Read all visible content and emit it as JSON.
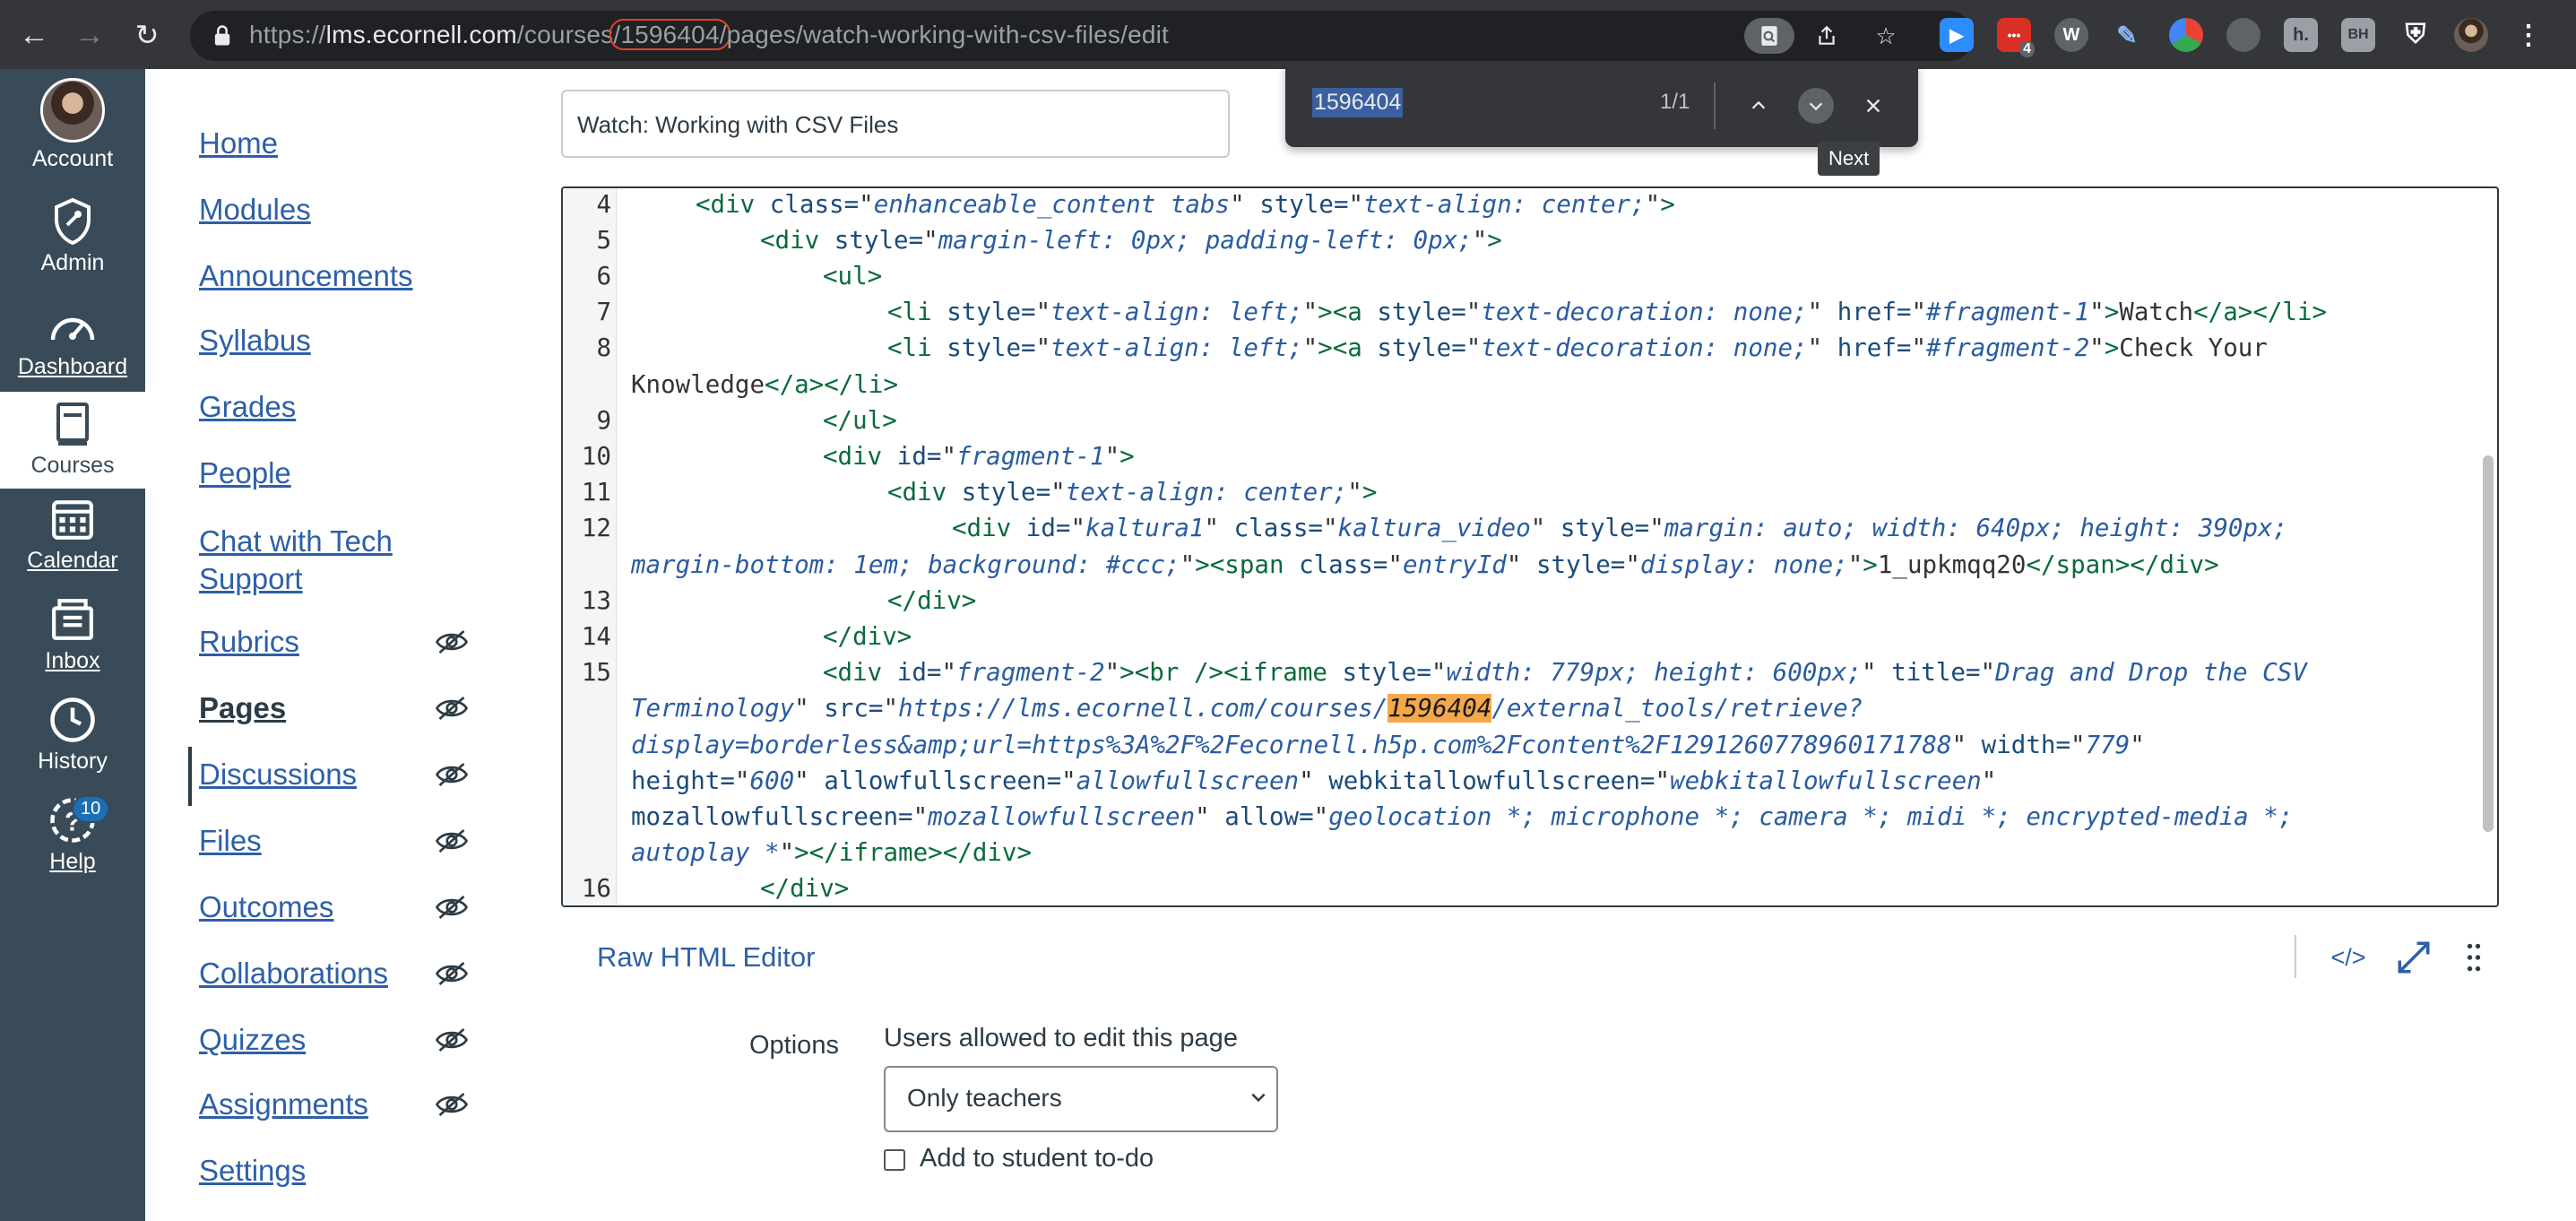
{
  "browser": {
    "url_prefix": "https://",
    "url_host": "lms.ecornell.com",
    "url_path_a": "/courses",
    "url_highlight": "/1596404/",
    "url_path_b": "pages/watch-working-with-csv-files/edit",
    "ext_badge": "4"
  },
  "global_nav": {
    "account": "Account",
    "admin": "Admin",
    "dashboard": "Dashboard",
    "courses": "Courses",
    "calendar": "Calendar",
    "inbox": "Inbox",
    "history": "History",
    "help": "Help",
    "help_badge": "10"
  },
  "course_nav": {
    "items": [
      {
        "label": "Home"
      },
      {
        "label": "Modules"
      },
      {
        "label": "Announcements"
      },
      {
        "label": "Syllabus"
      },
      {
        "label": "Grades"
      },
      {
        "label": "People"
      },
      {
        "label": "Chat with Tech"
      },
      {
        "label": "Support"
      },
      {
        "label": "Rubrics"
      },
      {
        "label": "Pages"
      },
      {
        "label": "Discussions"
      },
      {
        "label": "Files"
      },
      {
        "label": "Outcomes"
      },
      {
        "label": "Collaborations"
      },
      {
        "label": "Quizzes"
      },
      {
        "label": "Assignments"
      },
      {
        "label": "Settings"
      }
    ]
  },
  "page": {
    "title_value": "Watch: Working with CSV Files"
  },
  "find": {
    "query": "1596404",
    "count": "1/1",
    "tooltip": "Next"
  },
  "code": {
    "line_numbers": [
      "4",
      "5",
      "6",
      "7",
      "8",
      "9",
      "10",
      "11",
      "12",
      "13",
      "14",
      "15",
      "16"
    ]
  },
  "editor": {
    "raw_html_label": "Raw HTML Editor",
    "toggle_label": "</>"
  },
  "options": {
    "label": "Options",
    "description": "Users allowed to edit this page",
    "select_value": "Only teachers",
    "todo_label": "Add to student to-do"
  }
}
